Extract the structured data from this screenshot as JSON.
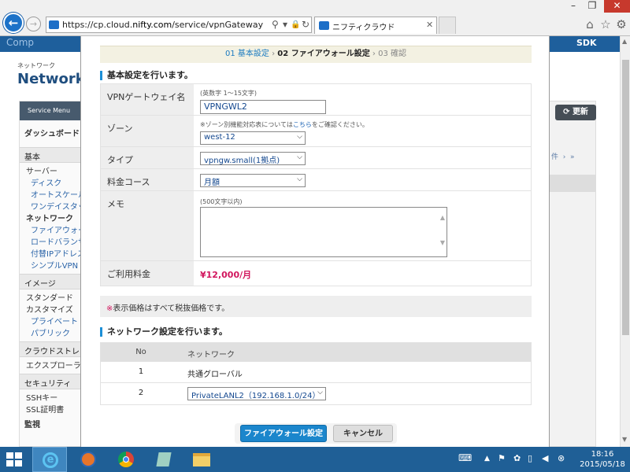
{
  "browser": {
    "url_prefix": "https://cp.cloud.",
    "url_domain": "nifty.com",
    "url_path": "/service/vpnGateway",
    "tab_title": "ニフティクラウド"
  },
  "background_page": {
    "header_text": "Comp",
    "header_right": "SDK",
    "breadcrumb": "ネットワーク",
    "title": "Network",
    "menu_label": "Service Menu",
    "update_button": "更新",
    "pager_fragment": "件",
    "sidebar": [
      {
        "type": "item",
        "label": "ダッシュボード"
      },
      {
        "type": "section",
        "label": "基本"
      },
      {
        "type": "sub",
        "label": "サーバー"
      },
      {
        "type": "sub2",
        "label": "ディスク"
      },
      {
        "type": "sub2",
        "label": "オートスケール"
      },
      {
        "type": "sub2",
        "label": "ワンデイスタック"
      },
      {
        "type": "bold",
        "label": "ネットワーク"
      },
      {
        "type": "sub2",
        "label": "ファイアウォール"
      },
      {
        "type": "sub2",
        "label": "ロードバランサー"
      },
      {
        "type": "sub2",
        "label": "付替IPアドレス"
      },
      {
        "type": "sub2",
        "label": "シンプルVPN"
      },
      {
        "type": "section",
        "label": "イメージ"
      },
      {
        "type": "sub",
        "label": "スタンダード"
      },
      {
        "type": "sub",
        "label": "カスタマイズ"
      },
      {
        "type": "sub2",
        "label": "プライベート"
      },
      {
        "type": "sub2",
        "label": "パブリック"
      },
      {
        "type": "section",
        "label": "クラウドストレージ"
      },
      {
        "type": "sub",
        "label": "エクスプローラー"
      },
      {
        "type": "section",
        "label": "セキュリティ"
      },
      {
        "type": "sub",
        "label": "SSHキー"
      },
      {
        "type": "sub",
        "label": "SSL証明書"
      },
      {
        "type": "item",
        "label": "監視"
      }
    ]
  },
  "modal": {
    "steps": {
      "s1": "01 基本設定",
      "s2": "02 ファイアウォール設定",
      "s3": "03 確認",
      "sep": "›"
    },
    "basic_heading": "基本設定を行います。",
    "fields": {
      "name_label": "VPNゲートウェイ名",
      "name_hint": "(英数字 1～15文字)",
      "name_value": "VPNGWL2",
      "zone_label": "ゾーン",
      "zone_hint_pre": "※ゾーン別機能対応表については",
      "zone_hint_link": "こちら",
      "zone_hint_post": "をご確認ください。",
      "zone_value": "west-12",
      "type_label": "タイプ",
      "type_value": "vpngw.small(1拠点)",
      "course_label": "料金コース",
      "course_value": "月額",
      "memo_label": "メモ",
      "memo_hint": "(500文字以内)",
      "fee_label": "ご利用料金",
      "fee_value": "¥12,000/月"
    },
    "note_mark": "※",
    "note_text": "表示価格はすべて税抜価格です。",
    "network_heading": "ネットワーク設定を行います。",
    "network_table": {
      "col_no": "No",
      "col_network": "ネットワーク",
      "rows": [
        {
          "no": "1",
          "network": "共通グローバル"
        },
        {
          "no": "2",
          "network": "PrivateLANL2（192.168.1.0/24）"
        }
      ]
    },
    "apply_button": "ファイアウォール設定へ",
    "cancel_button": "キャンセル"
  },
  "taskbar": {
    "time": "18:16",
    "date": "2015/05/18"
  },
  "colors": {
    "accent_blue": "#1b86cc",
    "price_pink": "#d1155d",
    "taskbar": "#1f5f96"
  }
}
